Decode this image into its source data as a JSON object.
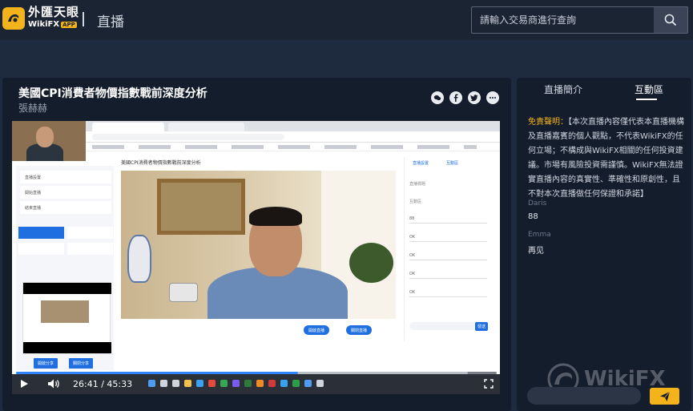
{
  "header": {
    "brand_cn": "外匯天眼",
    "brand_en": "WikiFX",
    "brand_app": "APP",
    "page_title": "直播",
    "search_placeholder": "請輸入交易商進行查詢",
    "icons": {
      "logo": "wikifx-logo-icon",
      "search": "search-icon"
    }
  },
  "live": {
    "title": "美國CPI消費者物價指數戰前深度分析",
    "host": "張赫赫",
    "share_icons": [
      "wechat-icon",
      "facebook-icon",
      "twitter-icon",
      "more-icon"
    ]
  },
  "player": {
    "time": "26:41 / 45:33",
    "progress_fraction": 0.586,
    "buffered_fraction": 0.94,
    "icons": {
      "play": "play-icon",
      "volume": "volume-icon",
      "fullscreen": "fullscreen-icon"
    },
    "screen_content": {
      "stream_title": "美國CPI消費者物價指數戰前深度分析",
      "sidebar_items": [
        "直播設置",
        "開始直播",
        "結束直播"
      ],
      "stream_buttons": [
        "開啟直播",
        "關閉直播"
      ],
      "bottom_buttons": [
        "開啟分享",
        "關閉分享"
      ],
      "panel_tabs": [
        "直播設置",
        "互動區"
      ],
      "panel_labels": [
        "直播標題",
        "互動區"
      ],
      "panel_values": [
        "88",
        "OK",
        "OK",
        "OK",
        "OK"
      ],
      "panel_send": "發送"
    }
  },
  "sidebar": {
    "tabs": [
      {
        "label": "直播簡介",
        "active": false
      },
      {
        "label": "互動區",
        "active": true
      }
    ],
    "disclaimer_label": "免責聲明：",
    "disclaimer_text": "【本次直播內容僅代表本直播機構及直播嘉賓的個人觀點，不代表WikiFX的任何立場；不構成與WikiFX相關的任何投資建議。市場有風險投資需謹慎。WikiFX無法證實直播內容的真實性、準確性和原創性，且不對本次直播做任何保證和承諾】",
    "messages": [
      {
        "user": "Daris",
        "text": "88"
      },
      {
        "user": "Emma",
        "text": "再见"
      }
    ],
    "watermark": "WikiFX",
    "icons": {
      "send": "send-icon",
      "watermark": "wikifx-watermark-icon"
    }
  },
  "colors": {
    "background": "#1e2a3d",
    "card": "#141d2c",
    "accent": "#f4b31a",
    "progress": "#2f85ff"
  }
}
